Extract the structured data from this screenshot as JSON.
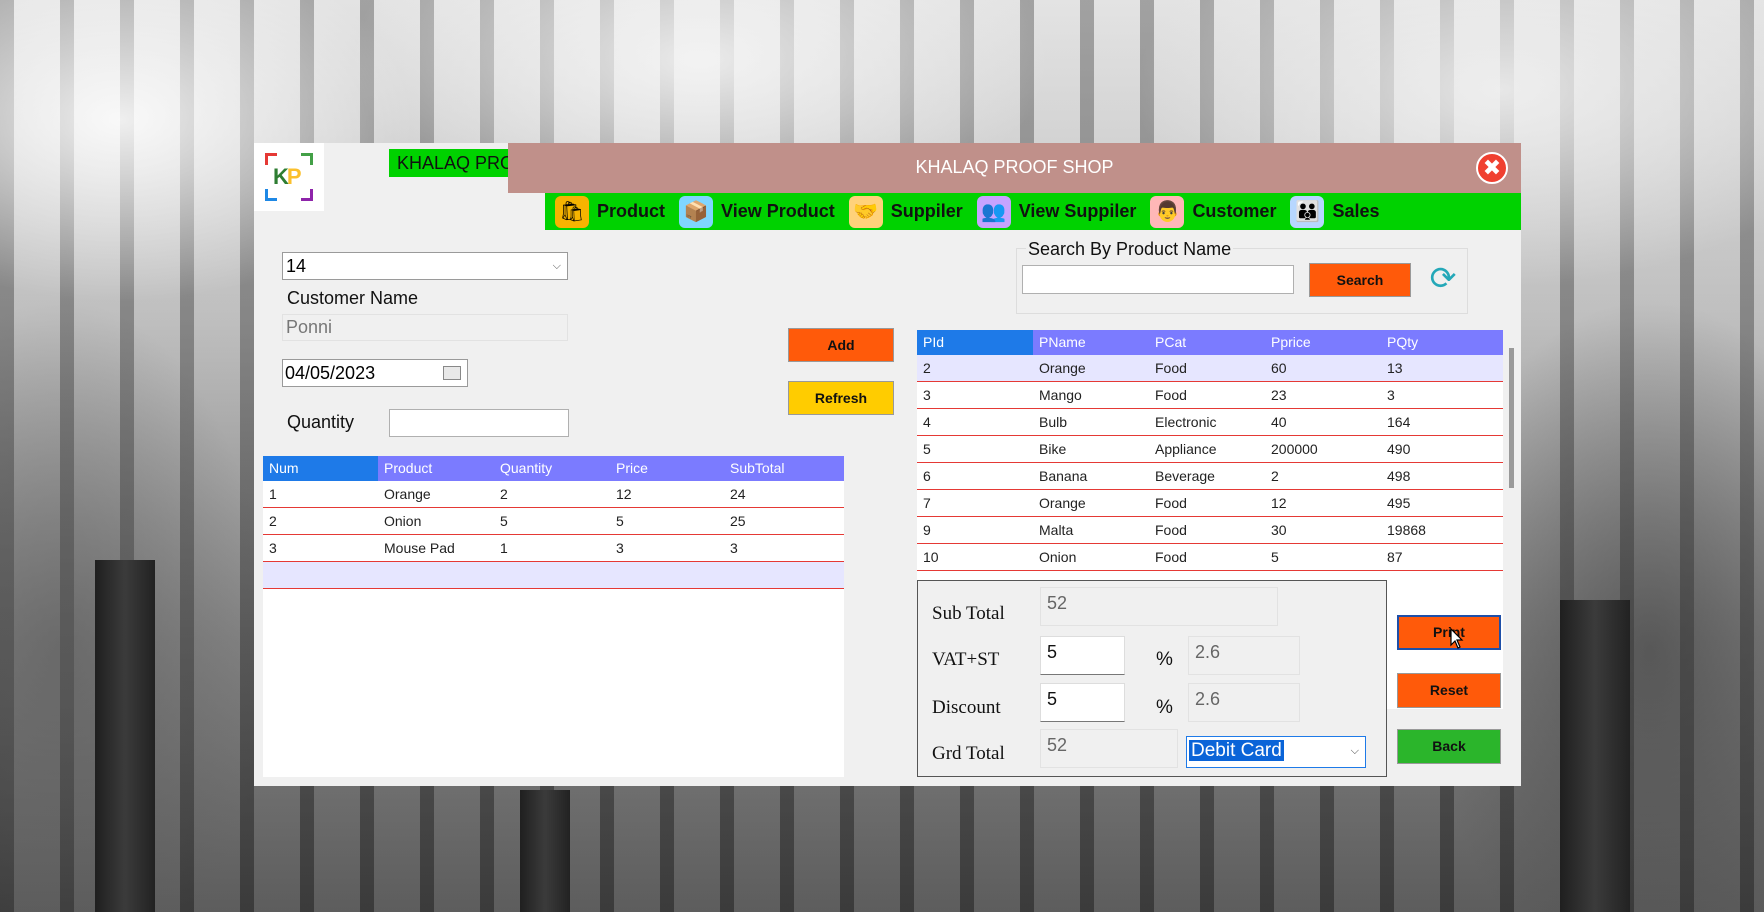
{
  "window": {
    "brand_label": "KHALAQ PROOF",
    "title": "KHALAQ PROOF SHOP",
    "close_glyph": "✖",
    "logo_letters": [
      "K",
      "P"
    ]
  },
  "nav": [
    {
      "label": "Product",
      "icon": "shopping-bag-icon",
      "glyph": "🛍",
      "color": "#f6b400"
    },
    {
      "label": "View Product",
      "icon": "product-box-icon",
      "glyph": "📦",
      "color": "#7fd6ff"
    },
    {
      "label": "Suppiler",
      "icon": "handshake-icon",
      "glyph": "🤝",
      "color": "#ffd27a"
    },
    {
      "label": "View Suppiler",
      "icon": "people-group-icon",
      "glyph": "👥",
      "color": "#c7a3ff"
    },
    {
      "label": "Customer",
      "icon": "customer-icon",
      "glyph": "👨",
      "color": "#ffb7b7"
    },
    {
      "label": "Sales",
      "icon": "sales-team-icon",
      "glyph": "👪",
      "color": "#b7d7ff"
    }
  ],
  "form": {
    "customer_id": "14",
    "customer_name_label": "Customer Name",
    "customer_name_value": "Ponni",
    "date_value": "04/05/2023",
    "quantity_label": "Quantity",
    "quantity_value": "",
    "add_label": "Add",
    "refresh_label": "Refresh"
  },
  "colors": {
    "add_button": "#ff5a0a",
    "refresh_button": "#ffcc00",
    "search_button": "#ff5a0a",
    "print_button": "#ff5a0a",
    "reset_button": "#ff5a0a",
    "back_button": "#2bb52b",
    "grid_header": "#7b7bff",
    "grid_header_selected": "#1e7ae8",
    "row_separator": "#e53935"
  },
  "cart": {
    "columns": [
      "Num",
      "Product",
      "Quantity",
      "Price",
      "SubTotal"
    ],
    "rows": [
      [
        "1",
        "Orange",
        "2",
        "12",
        "24"
      ],
      [
        "2",
        "Onion",
        "5",
        "5",
        "25"
      ],
      [
        "3",
        "Mouse Pad",
        "1",
        "3",
        "3"
      ],
      [
        "",
        "",
        "",
        "",
        ""
      ]
    ]
  },
  "search": {
    "group_label": "Search By Product Name",
    "value": "",
    "button_label": "Search",
    "refresh_icon": "refresh-icon"
  },
  "products": {
    "columns": [
      "PId",
      "PName",
      "PCat",
      "Pprice",
      "PQty"
    ],
    "rows": [
      [
        "2",
        "Orange",
        "Food",
        "60",
        "13"
      ],
      [
        "3",
        "Mango",
        "Food",
        "23",
        "3"
      ],
      [
        "4",
        "Bulb",
        "Electronic",
        "40",
        "164"
      ],
      [
        "5",
        "Bike",
        "Appliance",
        "200000",
        "490"
      ],
      [
        "6",
        "Banana",
        "Beverage",
        "2",
        "498"
      ],
      [
        "7",
        "Orange",
        "Food",
        "12",
        "495"
      ],
      [
        "9",
        "Malta",
        "Food",
        "30",
        "19868"
      ],
      [
        "10",
        "Onion",
        "Food",
        "5",
        "87"
      ]
    ]
  },
  "totals": {
    "sub_total_label": "Sub Total",
    "sub_total_value": "52",
    "vat_label": "VAT+ST",
    "vat_percent": "5",
    "vat_amount": "2.6",
    "discount_label": "Discount",
    "discount_percent": "5",
    "discount_amount": "2.6",
    "percent_sign": "%",
    "grand_total_label": "Grd Total",
    "grand_total_value": "52",
    "payment_method": "Debit Card"
  },
  "actions": {
    "print_label": "Print",
    "reset_label": "Reset",
    "back_label": "Back"
  }
}
